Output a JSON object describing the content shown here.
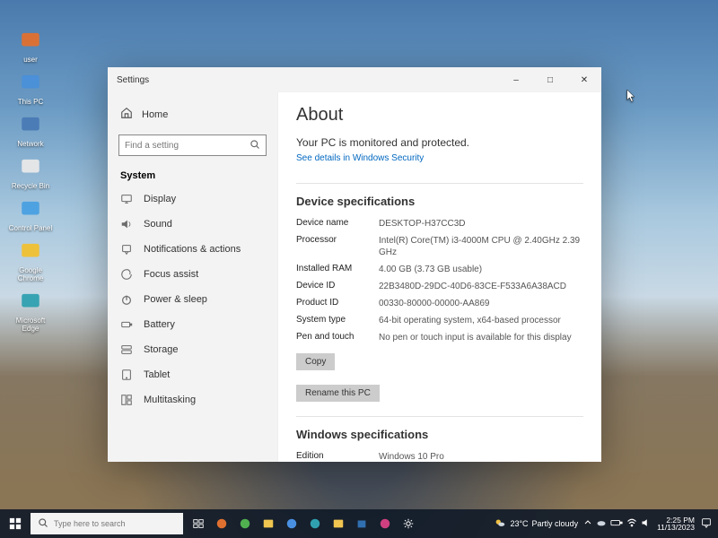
{
  "window": {
    "app_name": "Settings",
    "minimize": "–",
    "maximize": "□",
    "close": "✕"
  },
  "sidebar": {
    "home": "Home",
    "search_placeholder": "Find a setting",
    "category": "System",
    "items": [
      {
        "label": "Display",
        "icon": "display-icon"
      },
      {
        "label": "Sound",
        "icon": "sound-icon"
      },
      {
        "label": "Notifications & actions",
        "icon": "notifications-icon"
      },
      {
        "label": "Focus assist",
        "icon": "focus-icon"
      },
      {
        "label": "Power & sleep",
        "icon": "power-icon"
      },
      {
        "label": "Battery",
        "icon": "battery-icon"
      },
      {
        "label": "Storage",
        "icon": "storage-icon"
      },
      {
        "label": "Tablet",
        "icon": "tablet-icon"
      },
      {
        "label": "Multitasking",
        "icon": "multitasking-icon"
      }
    ]
  },
  "about": {
    "title": "About",
    "protected_line": "Your PC is monitored and protected.",
    "security_link": "See details in Windows Security",
    "dev_spec_title": "Device specifications",
    "specs": [
      {
        "k": "Device name",
        "v": "DESKTOP-H37CC3D"
      },
      {
        "k": "Processor",
        "v": "Intel(R) Core(TM) i3-4000M CPU @ 2.40GHz  2.39 GHz"
      },
      {
        "k": "Installed RAM",
        "v": "4.00 GB (3.73 GB usable)"
      },
      {
        "k": "Device ID",
        "v": "22B3480D-29DC-40D6-83CE-F533A6A38ACD"
      },
      {
        "k": "Product ID",
        "v": "00330-80000-00000-AA869"
      },
      {
        "k": "System type",
        "v": "64-bit operating system, x64-based processor"
      },
      {
        "k": "Pen and touch",
        "v": "No pen or touch input is available for this display"
      }
    ],
    "copy_btn": "Copy",
    "rename_btn": "Rename this PC",
    "win_spec_title": "Windows specifications",
    "win_specs": [
      {
        "k": "Edition",
        "v": "Windows 10 Pro"
      }
    ]
  },
  "desktop_icons": [
    {
      "label": "user",
      "color": "#e07030"
    },
    {
      "label": "This PC",
      "color": "#4a90d9"
    },
    {
      "label": "Network",
      "color": "#4a7ab5"
    },
    {
      "label": "Recycle Bin",
      "color": "#e8e8e8"
    },
    {
      "label": "Control Panel",
      "color": "#4aa0e0"
    },
    {
      "label": "Google Chrome",
      "color": "#f0c030"
    },
    {
      "label": "Microsoft Edge",
      "color": "#30a0b0"
    }
  ],
  "taskbar": {
    "search_placeholder": "Type here to search",
    "weather": {
      "temp": "23°C",
      "text": "Partly cloudy"
    },
    "time": "2:25 PM",
    "date": "11/13/2023"
  }
}
